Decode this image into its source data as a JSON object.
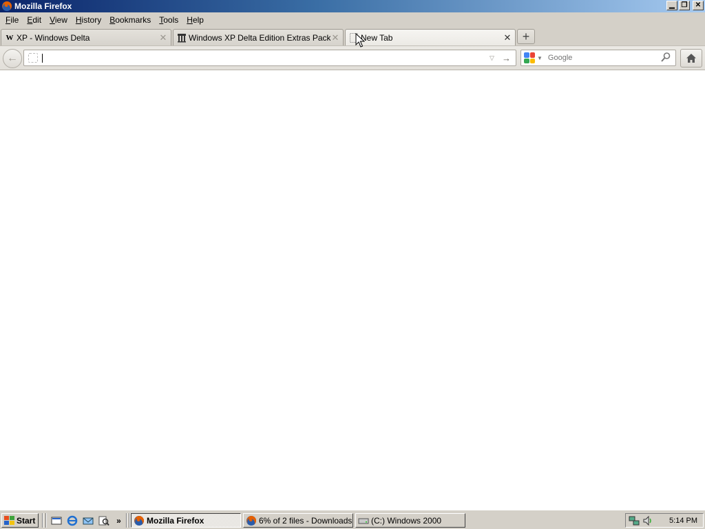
{
  "window": {
    "title": "Mozilla Firefox",
    "controls": [
      "minimize-icon",
      "restore-icon",
      "close-icon"
    ]
  },
  "menu": {
    "items": [
      {
        "accel": "F",
        "rest": "ile"
      },
      {
        "accel": "E",
        "rest": "dit"
      },
      {
        "accel": "V",
        "rest": "iew"
      },
      {
        "accel": "H",
        "rest": "istory"
      },
      {
        "accel": "B",
        "rest": "ookmarks"
      },
      {
        "accel": "T",
        "rest": "ools"
      },
      {
        "accel": "H",
        "rest": "elp"
      }
    ]
  },
  "tabs": [
    {
      "label": "XP - Windows Delta",
      "icon": "wikipedia-icon",
      "active": false
    },
    {
      "label": "Windows XP Delta Edition Extras Pack : S...",
      "icon": "archive-icon",
      "active": false
    },
    {
      "label": "New Tab",
      "icon": "blank-page-icon",
      "active": true
    }
  ],
  "new_tab_label": "+",
  "nav": {
    "back_icon": "back-arrow-icon",
    "url_value": "",
    "search_placeholder": "Google",
    "search_engine_icon": "google-icon",
    "home_icon": "home-icon"
  },
  "taskbar": {
    "start_label": "Start",
    "quick_launch": [
      "show-desktop-icon",
      "internet-explorer-icon",
      "outlook-express-icon",
      "search-icon"
    ],
    "overflow_label": "»",
    "tasks": [
      {
        "label": "Mozilla Firefox",
        "icon": "firefox-icon",
        "active": true
      },
      {
        "label": "6% of 2 files - Downloads",
        "icon": "firefox-icon",
        "active": false
      },
      {
        "label": "(C:) Windows 2000",
        "icon": "drive-icon",
        "active": false
      }
    ],
    "tray_icons": [
      "network-icon",
      "volume-icon"
    ],
    "clock": "5:14 PM"
  },
  "colors": {
    "title_gradient_start": "#0a246a",
    "title_gradient_end": "#a6caf0",
    "chrome": "#d4d0c8"
  }
}
